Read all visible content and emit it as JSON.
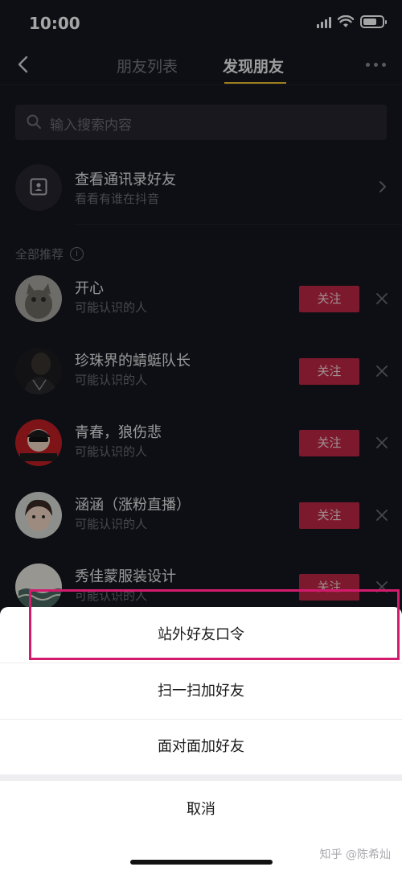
{
  "status": {
    "time": "10:00"
  },
  "nav": {
    "tabs": [
      {
        "label": "朋友列表",
        "active": false
      },
      {
        "label": "发现朋友",
        "active": true
      }
    ],
    "accent": "#f1c231"
  },
  "search": {
    "placeholder": "输入搜索内容"
  },
  "contacts": {
    "title": "查看通讯录好友",
    "subtitle": "看看有谁在抖音"
  },
  "section": {
    "label": "全部推荐"
  },
  "recommendations": [
    {
      "name": "开心",
      "subtitle": "可能认识的人",
      "button": "关注"
    },
    {
      "name": "珍珠界的蜻蜓队长",
      "subtitle": "可能认识的人",
      "button": "关注"
    },
    {
      "name": "青春，狼伤悲",
      "subtitle": "可能认识的人",
      "button": "关注"
    },
    {
      "name": "涵涵（涨粉直播）",
      "subtitle": "可能认识的人",
      "button": "关注"
    },
    {
      "name": "秀佳蒙服装设计",
      "subtitle": "可能认识的人",
      "button": "关注"
    }
  ],
  "sheet": {
    "items": [
      "站外好友口令",
      "扫一扫加好友",
      "面对面加好友"
    ],
    "cancel": "取消"
  },
  "watermark": "知乎 @陈希灿",
  "colors": {
    "follow_button": "#c12745",
    "highlight_box": "#d31b6e",
    "background": "#16171f"
  }
}
